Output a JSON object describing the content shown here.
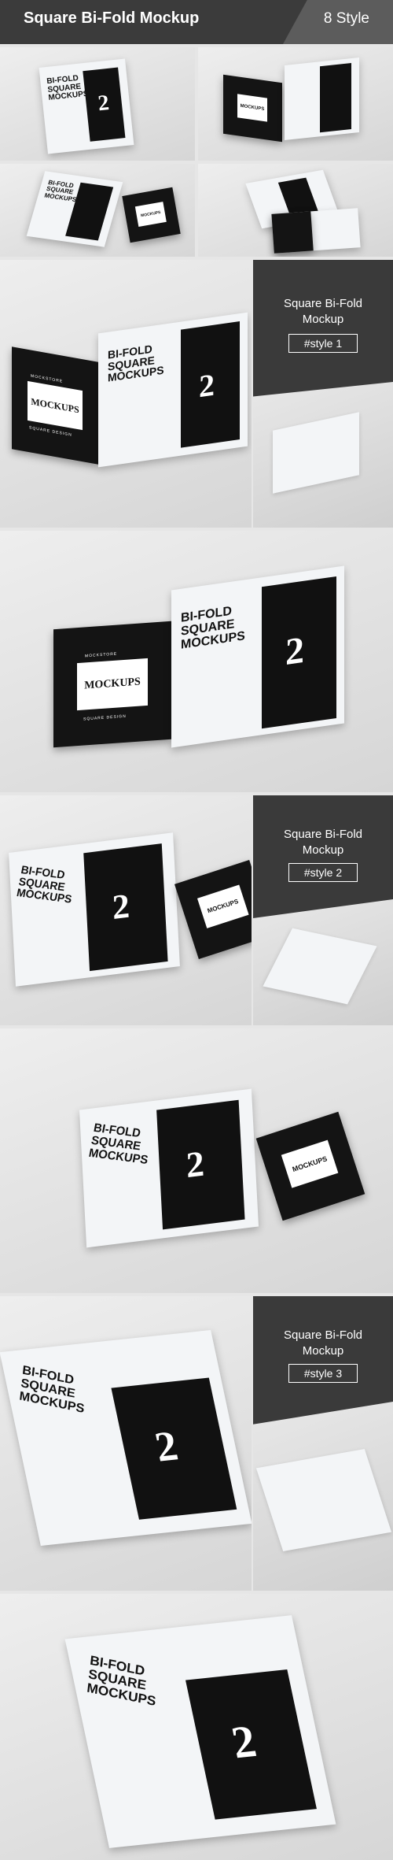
{
  "header": {
    "title": "Square Bi-Fold Mockup",
    "style_count": "8 Style"
  },
  "panels": [
    {
      "title": "Square Bi-Fold\nMockup",
      "badge": "#style 1"
    },
    {
      "title": "Square Bi-Fold\nMockup",
      "badge": "#style 2"
    },
    {
      "title": "Square Bi-Fold\nMockup",
      "badge": "#style 3"
    }
  ],
  "brochure": {
    "headline": [
      "BI-FOLD",
      "SQUARE",
      "MOCKUPS"
    ],
    "number": "2",
    "cover_top": "MOCKSTORE",
    "cover_main": "MOCKUPS",
    "cover_bottom": "SQUARE DESIGN"
  }
}
